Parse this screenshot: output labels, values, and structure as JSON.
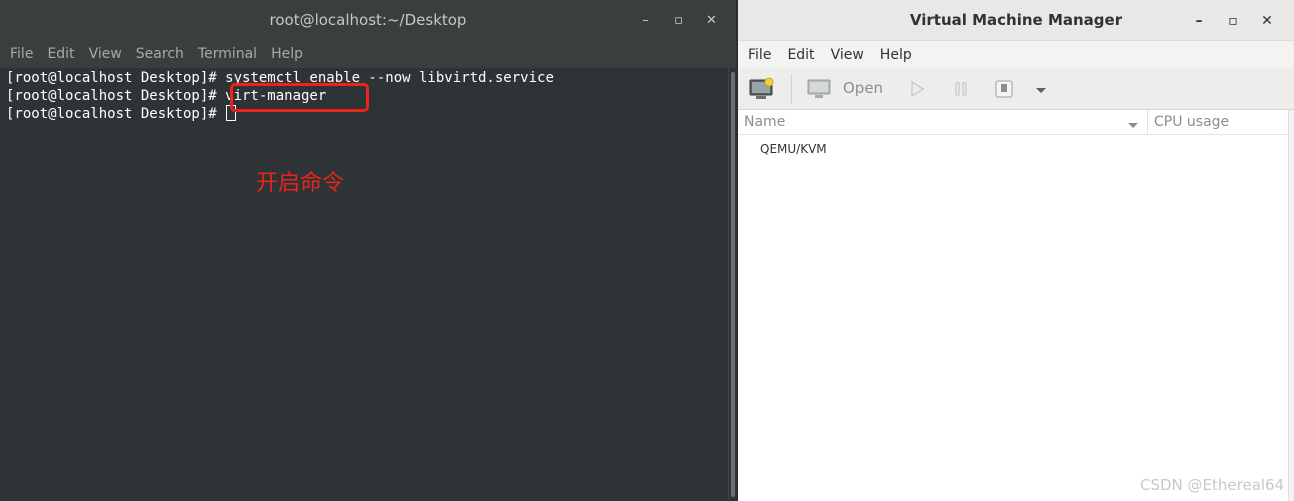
{
  "terminal": {
    "title": "root@localhost:~/Desktop",
    "controls": {
      "minimize": "–",
      "maximize": "▫",
      "close": "✕"
    },
    "menu": [
      "File",
      "Edit",
      "View",
      "Search",
      "Terminal",
      "Help"
    ],
    "lines": [
      "[root@localhost Desktop]# systemctl enable --now libvirtd.service",
      "[root@localhost Desktop]# virt-manager",
      "[root@localhost Desktop]# "
    ],
    "annotation": "开启命令",
    "highlight_color": "#e8241c"
  },
  "vmm": {
    "title": "Virtual Machine Manager",
    "controls": {
      "minimize": "–",
      "maximize": "▫",
      "close": "✕"
    },
    "menu": [
      "File",
      "Edit",
      "View",
      "Help"
    ],
    "toolbar": {
      "open_label": "Open"
    },
    "columns": {
      "name": "Name",
      "cpu": "CPU usage"
    },
    "connections": [
      {
        "label": "QEMU/KVM"
      }
    ]
  },
  "watermark": "CSDN @Ethereal64",
  "colors": {
    "terminal_bg": "#2e3436",
    "titlebar_dark": "#393f3f",
    "vmm_bg": "#ffffff"
  }
}
